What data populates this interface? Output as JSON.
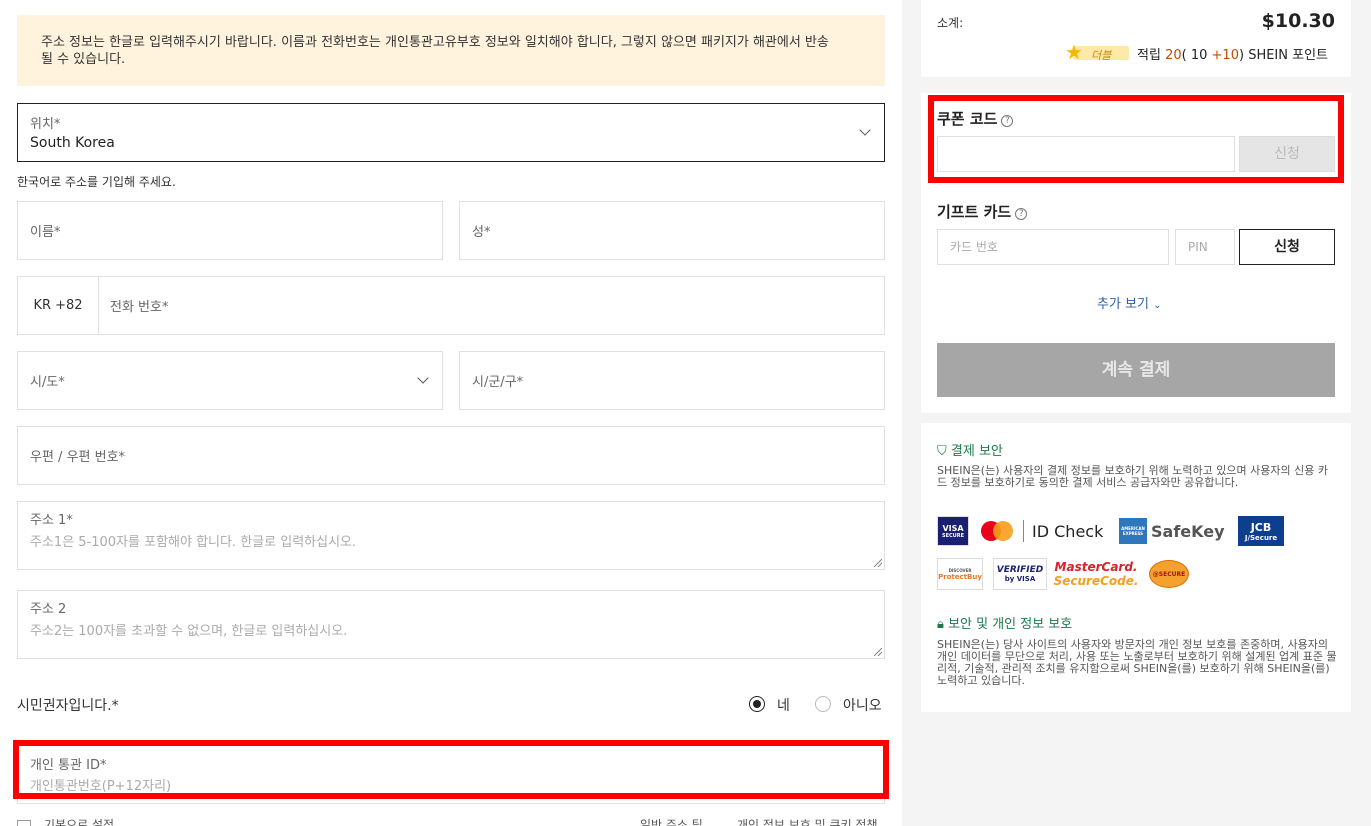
{
  "notice": "주소 정보는 한글로 입력해주시기 바랍니다. 이름과 전화번호는 개인통관고유부호 정보와 일치해야 합니다, 그렇지 않으면 패키지가 해관에서 반송될 수 있습니다.",
  "location": {
    "label": "위치*",
    "value": "South Korea"
  },
  "korean_hint": "한국어로 주소를 기입해 주세요.",
  "first_name": "이름*",
  "last_name": "성*",
  "phone": {
    "code": "KR +82",
    "placeholder": "전화 번호*"
  },
  "province": "시/도*",
  "city": "시/군/구*",
  "postcode": "우편 / 우편 번호*",
  "address1": {
    "label": "주소 1*",
    "placeholder": "주소1은 5-100자를 포함해야 합니다. 한글로 입력하십시오."
  },
  "address2": {
    "label": "주소 2",
    "placeholder": "주소2는 100자를 초과할 수 없으며, 한글로 입력하십시오."
  },
  "citizen": {
    "label": "시민권자입니다.*",
    "yes": "네",
    "no": "아니오"
  },
  "customs_id": {
    "label": "개인 통관 ID*",
    "placeholder": "개인통관번호(P+12자리)"
  },
  "bottom": {
    "default": "기본으로 설정",
    "tip": "일반 주소 팁",
    "privacy": "개인 정보 보호 및 쿠키 정책"
  },
  "summary": {
    "subtotal_label": "소계:",
    "subtotal_value": "$10.30",
    "double_label": "더블",
    "points_prefix": "적립",
    "points_total": "20",
    "points_open": "(",
    "points_a": "10",
    "points_plus": "+",
    "points_b": "10",
    "points_close": ")",
    "points_suffix": "SHEIN 포인트"
  },
  "coupon": {
    "title": "쿠폰 코드",
    "apply": "신청"
  },
  "gift": {
    "title": "기프트 카드",
    "card_placeholder": "카드 번호",
    "pin_placeholder": "PIN",
    "apply": "신청"
  },
  "more": "추가 보기",
  "continue": "계속 결제",
  "security": {
    "pay_title": "결제 보안",
    "pay_text": "SHEIN은(는) 사용자의 결제 정보를 보호하기 위해 노력하고 있으며 사용자의 신용 카드 정보를 보호하기로 동의한 결제 서비스 공급자와만 공유합니다.",
    "privacy_title": "보안 및 개인 정보 보호",
    "privacy_text": "SHEIN은(는) 당사 사이트의 사용자와 방문자의 개인 정보 보호를 존중하며, 사용자의 개인 데이터를 무단으로 처리, 사용 또는 노출로부터 보호하기 위해 설계된 업계 표준 물리적, 기술적, 관리적 조치를 유지함으로써 SHEIN을(를) 보호하기 위해 SHEIN을(를) 노력하고 있습니다."
  },
  "logos": {
    "visa": "VISA",
    "visa_sub": "SECURE",
    "mc_id": "ID Check",
    "amex": "AMERICAN EXPRESS",
    "safekey": "SafeKey",
    "jcb": "JCB",
    "jcb_sub": "J/Secure",
    "discover": "DISCOVER",
    "protectbuy": "ProtectBuy",
    "verified": "VERIFIED",
    "by_visa": "by VISA",
    "mastercard": "MasterCard.",
    "securecode": "SecureCode.",
    "bsecure": "@SECURE"
  }
}
